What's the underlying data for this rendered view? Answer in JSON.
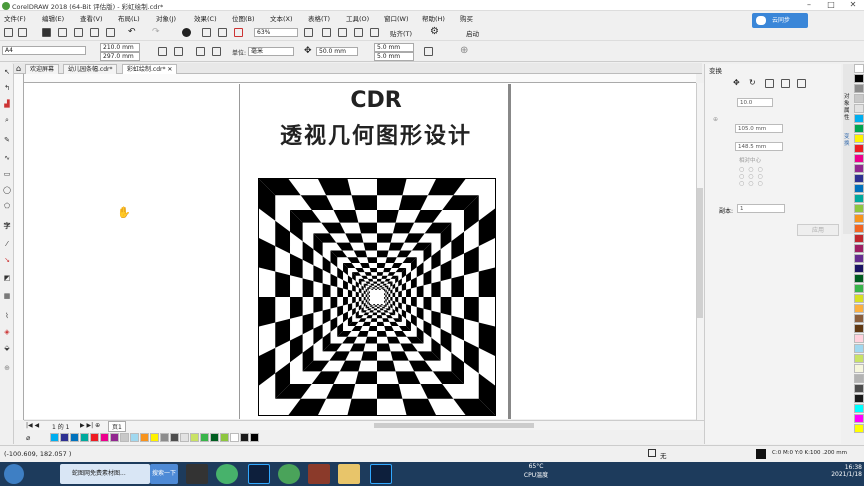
{
  "window": {
    "title": "CorelDRAW 2018 (64-Bit 评估版) - 彩虹绘制.cdr*"
  },
  "cloud_button": {
    "label": "云同步"
  },
  "menu": [
    "文件(F)",
    "编辑(E)",
    "查看(V)",
    "布局(L)",
    "对象(J)",
    "效果(C)",
    "位图(B)",
    "文本(X)",
    "表格(T)",
    "工具(O)",
    "窗口(W)",
    "帮助(H)",
    "购买"
  ],
  "toolbar": {
    "zoom": "63%",
    "snap_label": "贴齐(T)",
    "launch_label": "启动"
  },
  "props": {
    "page_size": "A4",
    "width": "210.0 mm",
    "height": "297.0 mm",
    "units_label": "单位:",
    "units": "毫米",
    "nudge": "50.0 mm",
    "dup_x": "5.0 mm",
    "dup_y": "5.0 mm"
  },
  "tabs": [
    {
      "label": "欢迎屏幕"
    },
    {
      "label": "幼儿园条幅.cdr*"
    },
    {
      "label": "彩虹绘制.cdr*"
    }
  ],
  "page": {
    "title_line1": "CDR",
    "title_line2": "透视几何图形设计"
  },
  "docker": {
    "title": "变换",
    "angle": "10.0",
    "size_w": "105.0 mm",
    "size_h": "148.5 mm",
    "relative_center": "相对中心",
    "copies_label": "副本:",
    "copies": "1",
    "apply_label": "应用",
    "side_tabs": [
      "对象属性",
      "变换"
    ]
  },
  "page_nav": {
    "text": "1 的 1",
    "page_tab": "页1"
  },
  "status": {
    "coords": "(-100.609, 182.057 )",
    "fill_label": "C:0 M:0 Y:0 K:100  .200 mm",
    "outline": "无"
  },
  "taskbar": {
    "items": [
      "蛇图网免费素材图...",
      "搜索一下"
    ],
    "weather_temp": "65°C",
    "weather_label": "CPU温度",
    "time": "16:38",
    "date": "2021/1/18"
  },
  "palette_colors": [
    "#ffffff",
    "#000000",
    "#8c8c8c",
    "#c8c8c8",
    "#e2e2e2",
    "#00aeef",
    "#00a651",
    "#fff200",
    "#ed1c24",
    "#ec008c",
    "#92278f",
    "#2e3192",
    "#0072bc",
    "#00a99d",
    "#8dc63f",
    "#f7941d",
    "#f26522",
    "#c1272d",
    "#9e1f63",
    "#662d91",
    "#1b1464",
    "#005e20",
    "#39b54a",
    "#d7df23",
    "#fbb040",
    "#8b5e3c",
    "#603913",
    "#ffd1dc",
    "#a0d8ef",
    "#c9e265",
    "#f5f5dc",
    "#b3b3b3",
    "#4d4d4d",
    "#1a1a1a",
    "#00ffff",
    "#ff00ff",
    "#ffff00"
  ],
  "palette_h_colors": [
    "#00aeef",
    "#2e3192",
    "#0072bc",
    "#00a99d",
    "#ed1c24",
    "#ec008c",
    "#92278f",
    "#c8c8c8",
    "#a0d8ef",
    "#f7941d",
    "#fff200",
    "#8c8c8c",
    "#4d4d4d",
    "#e2e2e2",
    "#c9e265",
    "#39b54a",
    "#005e20",
    "#8dc63f",
    "#ffffff",
    "#1a1a1a",
    "#000000"
  ]
}
